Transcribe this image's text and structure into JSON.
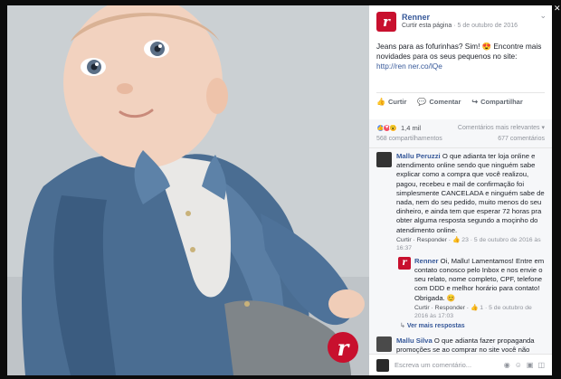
{
  "post": {
    "page_name": "Renner",
    "follow_label": "Curtir esta página",
    "date": "5 de outubro de 2016",
    "separator": " · ",
    "text": "Jeans para as fofurinhas? Sim! 😍 Encontre mais novidades para os seus pequenos no site: ",
    "link": "http://ren ner.co/lQe",
    "logo_letter": "r"
  },
  "actions": {
    "like": "Curtir",
    "comment": "Comentar",
    "share": "Compartilhar"
  },
  "reactions": {
    "count": "1,4 mil",
    "order": "Comentários mais relevantes ▾",
    "shares": "568 compartilhamentos",
    "comments": "677 comentários"
  },
  "comments": [
    {
      "name": "Mallu Peruzzi",
      "text": " O que adianta ter loja online e atendimento online sendo que ninguém sabe explicar como a compra que você realizou, pagou, recebeu e mail de confirmação foi simplesmente CANCELADA e ninguém sabe de nada, nem do seu pedido, muito menos do seu dinheiro, e ainda tem que esperar 72 horas pra obter alguma resposta segundo a moçinho do atendimento online.",
      "meta_actions": "Curtir · Responder · ",
      "meta_likes": "👍 23",
      "meta_date": " · 5 de outubro de 2016 às 16:37"
    }
  ],
  "reply": {
    "name": "Renner",
    "text": " Oi, Mallu! Lamentamos! Entre em contato conosco pelo Inbox e nos envie o seu relato, nome completo, CPF, telefone com DDD e melhor horário para contato! Obrigada. 😊",
    "meta_actions": "Curtir · Responder · ",
    "meta_likes": "👍 1",
    "meta_date": " · 5 de outubro de 2016 às 17:03"
  },
  "more_replies": "Ver mais respostas",
  "second_comment": {
    "name": "Mallu Silva",
    "text": " O que adianta fazer propaganda promoções se ao comprar no site você não"
  },
  "write": {
    "placeholder": "Escreva um comentário..."
  },
  "icons": [
    "chevron-down-icon",
    "like-icon",
    "comment-icon",
    "share-icon",
    "camera-icon",
    "emoji-icon",
    "gif-icon",
    "sticker-icon",
    "close-icon"
  ],
  "colors": {
    "brand": "#c8102e",
    "link": "#365899",
    "muted": "#90949c"
  }
}
